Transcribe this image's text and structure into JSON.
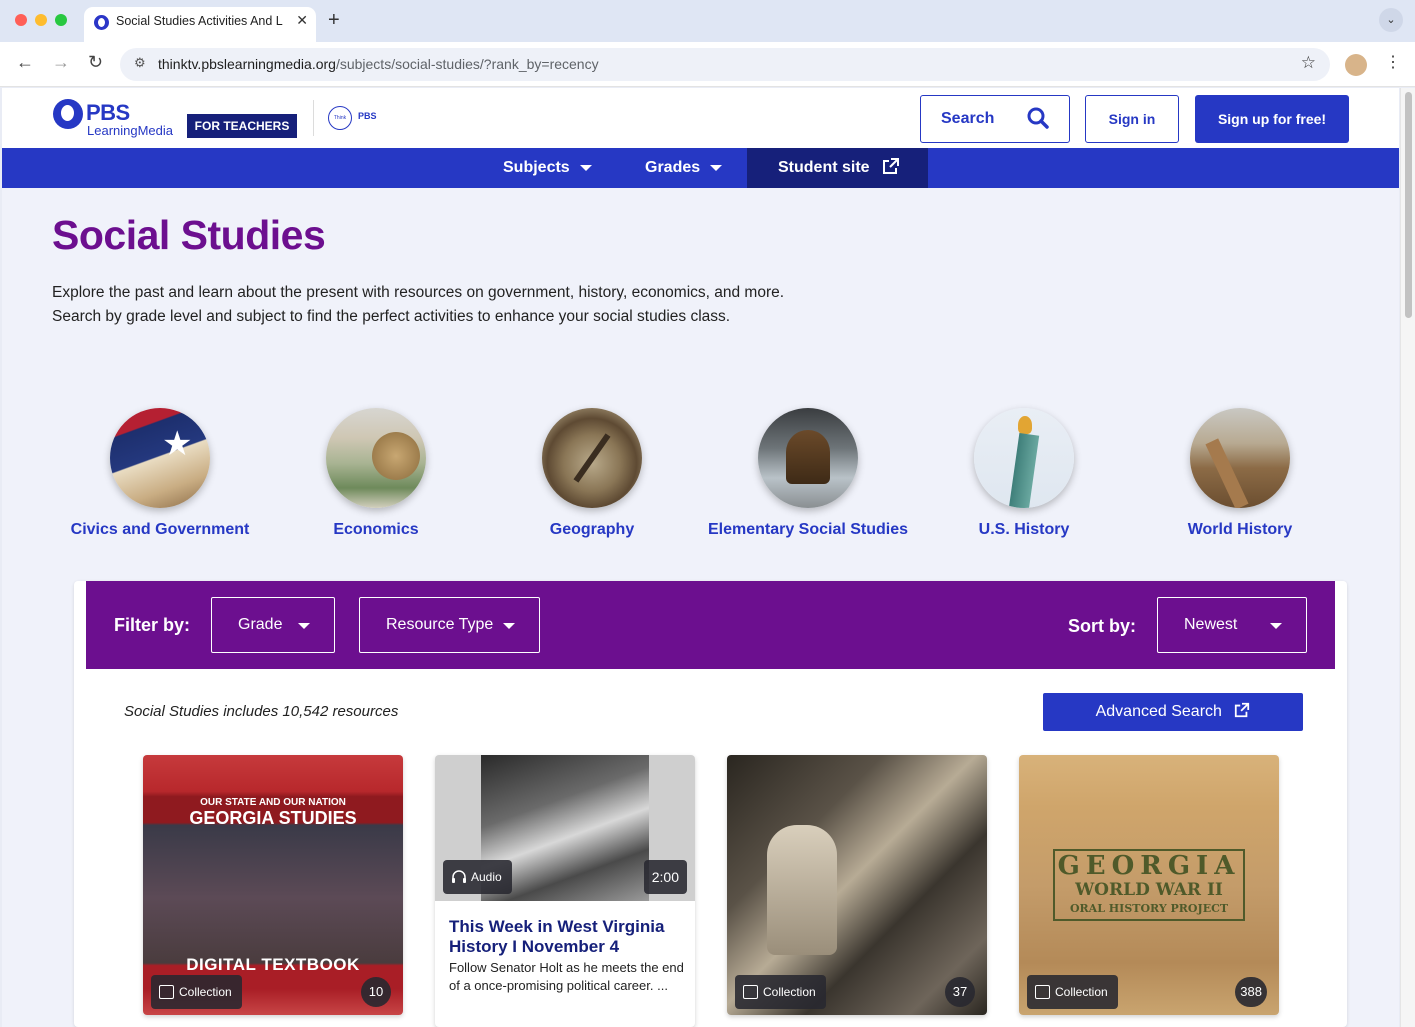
{
  "browser": {
    "tab_title": "Social Studies Activities And L",
    "url_host": "thinktv.pbslearningmedia.org",
    "url_path": "/subjects/social-studies/?rank_by=recency"
  },
  "header": {
    "logo_pbs": "PBS",
    "logo_sub": "LearningMedia",
    "for_teachers": "FOR TEACHERS",
    "station_think": "Think",
    "station_pbs": "PBS",
    "search_label": "Search",
    "signin_label": "Sign in",
    "signup_label": "Sign up for free!"
  },
  "nav": {
    "subjects": "Subjects",
    "grades": "Grades",
    "student_site": "Student site"
  },
  "page": {
    "title": "Social Studies",
    "intro_line1": "Explore the past and learn about the present with resources on government, history, economics, and more.",
    "intro_line2": "Search by grade level and subject to find the perfect activities to enhance your social studies class."
  },
  "topics": [
    {
      "label": "Civics and Government"
    },
    {
      "label": "Economics"
    },
    {
      "label": "Geography"
    },
    {
      "label": "Elementary Social Studies"
    },
    {
      "label": "U.S. History"
    },
    {
      "label": "World History"
    }
  ],
  "filters": {
    "filter_by": "Filter by:",
    "grade": "Grade",
    "resource_type": "Resource Type",
    "sort_by": "Sort by:",
    "sort_value": "Newest"
  },
  "results": {
    "count_text": "Social Studies includes 10,542 resources",
    "advanced_search": "Advanced Search"
  },
  "cards": [
    {
      "type": "Collection",
      "count": "10",
      "image_text_1": "OUR STATE AND OUR NATION",
      "image_text_2": "GEORGIA STUDIES",
      "image_text_3": "DIGITAL TEXTBOOK"
    },
    {
      "type": "Audio",
      "duration": "2:00",
      "title": "This Week in West Virginia History I November 4",
      "description": "Follow Senator Holt as he meets the end of a once-promising political career. ..."
    },
    {
      "type": "Collection",
      "count": "37"
    },
    {
      "type": "Collection",
      "count": "388",
      "image_text_1": "GEORGIA",
      "image_text_2": "WORLD WAR II",
      "image_text_3": "ORAL HISTORY PROJECT"
    }
  ],
  "colors": {
    "brand_blue": "#2638c4",
    "dark_navy": "#16207a",
    "purple": "#6c0f8f"
  }
}
